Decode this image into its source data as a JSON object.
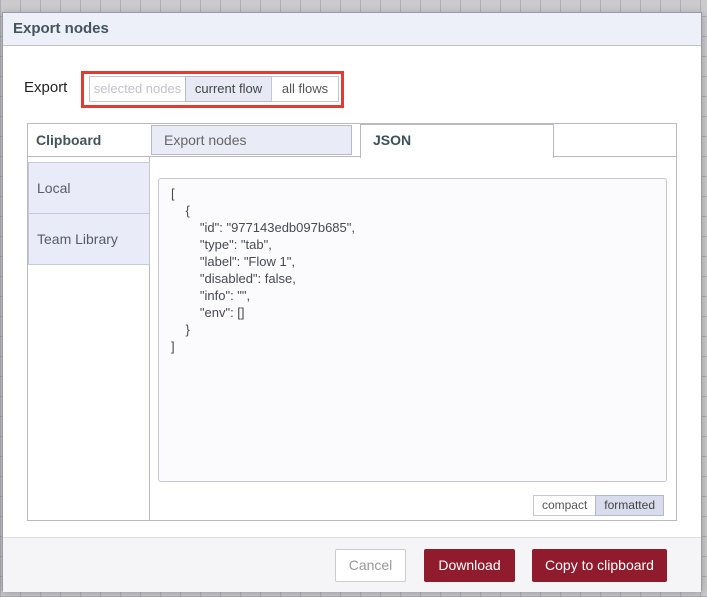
{
  "dialog": {
    "title": "Export nodes",
    "export_row": {
      "label": "Export",
      "scope_buttons": [
        {
          "label": "selected nodes",
          "state": "disabled"
        },
        {
          "label": "current flow",
          "state": "selected"
        },
        {
          "label": "all flows",
          "state": "normal"
        }
      ]
    },
    "destination_tabs": [
      {
        "label": "Clipboard",
        "state": "active"
      },
      {
        "label": "Local",
        "state": "inactive"
      },
      {
        "label": "Team Library",
        "state": "inactive"
      }
    ],
    "content_tabs": [
      {
        "label": "Export nodes",
        "state": "inactive"
      },
      {
        "label": "JSON",
        "state": "active"
      }
    ],
    "json_preview": "[\n    {\n        \"id\": \"977143edb097b685\",\n        \"type\": \"tab\",\n        \"label\": \"Flow 1\",\n        \"disabled\": false,\n        \"info\": \"\",\n        \"env\": []\n    }\n]",
    "format_buttons": [
      {
        "label": "compact",
        "state": "normal"
      },
      {
        "label": "formatted",
        "state": "selected"
      }
    ],
    "footer_buttons": [
      {
        "label": "Cancel",
        "style": "secondary"
      },
      {
        "label": "Download",
        "style": "primary"
      },
      {
        "label": "Copy to clipboard",
        "style": "primary"
      }
    ],
    "colors": {
      "primary_button": "#8f1b2c",
      "annotation_highlight": "#e23b31",
      "accent_background": "#e9ebf7",
      "header_background": "#edeff9"
    }
  }
}
